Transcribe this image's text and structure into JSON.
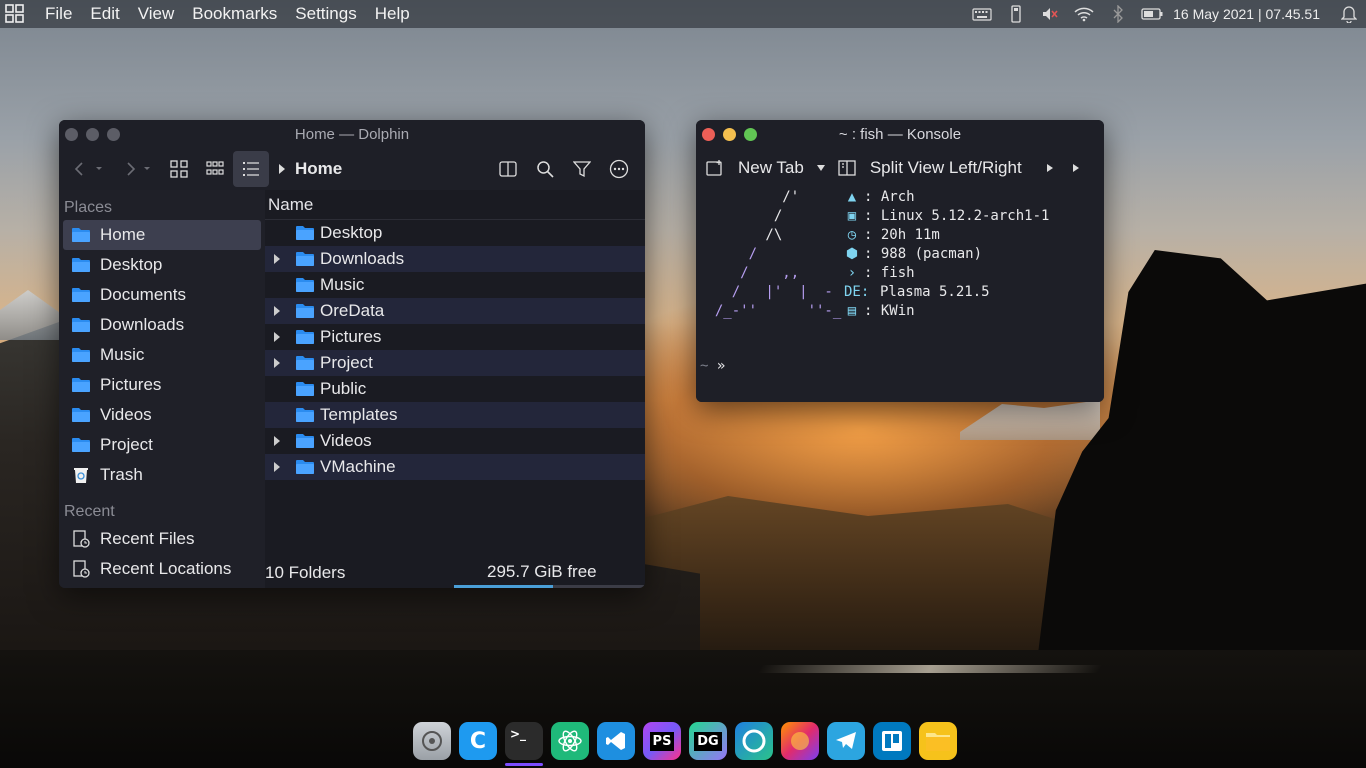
{
  "menubar": {
    "items": [
      "File",
      "Edit",
      "View",
      "Bookmarks",
      "Settings",
      "Help"
    ],
    "clock": "16 May 2021 | 07.45.51",
    "tray_icons": [
      "keyboard-icon",
      "usb-drive-icon",
      "volume-muted-icon",
      "wifi-icon",
      "bluetooth-icon",
      "battery-icon",
      "notification-bell-icon"
    ]
  },
  "dolphin": {
    "title": "Home — Dolphin",
    "breadcrumb": "Home",
    "places_heading": "Places",
    "places": [
      {
        "label": "Home",
        "icon": "home-folder-icon"
      },
      {
        "label": "Desktop",
        "icon": "desktop-folder-icon"
      },
      {
        "label": "Documents",
        "icon": "documents-folder-icon"
      },
      {
        "label": "Downloads",
        "icon": "downloads-folder-icon"
      },
      {
        "label": "Music",
        "icon": "music-folder-icon"
      },
      {
        "label": "Pictures",
        "icon": "pictures-folder-icon"
      },
      {
        "label": "Videos",
        "icon": "videos-folder-icon"
      },
      {
        "label": "Project",
        "icon": "project-folder-icon"
      },
      {
        "label": "Trash",
        "icon": "trash-icon"
      }
    ],
    "recent_heading": "Recent",
    "recent": [
      {
        "label": "Recent Files",
        "icon": "recent-files-icon"
      },
      {
        "label": "Recent Locations",
        "icon": "recent-locations-icon"
      }
    ],
    "column_header": "Name",
    "files": [
      {
        "name": "Desktop",
        "expandable": false
      },
      {
        "name": "Downloads",
        "expandable": true
      },
      {
        "name": "Music",
        "expandable": false
      },
      {
        "name": "OreData",
        "expandable": true
      },
      {
        "name": "Pictures",
        "expandable": true
      },
      {
        "name": "Project",
        "expandable": true
      },
      {
        "name": "Public",
        "expandable": false
      },
      {
        "name": "Templates",
        "expandable": false
      },
      {
        "name": "Videos",
        "expandable": true
      },
      {
        "name": "VMachine",
        "expandable": true
      }
    ],
    "status_count": "10 Folders",
    "free_space": "295.7 GiB free",
    "used_fraction": 0.52
  },
  "konsole": {
    "title": "~ : fish — Konsole",
    "new_tab": "New Tab",
    "split_view": "Split View Left/Right",
    "neofetch": [
      {
        "icon": "arch-linux-icon",
        "text": ": Arch"
      },
      {
        "icon": "kernel-icon",
        "text": ": Linux 5.12.2-arch1-1"
      },
      {
        "icon": "uptime-clock-icon",
        "text": ": 20h 11m"
      },
      {
        "icon": "package-icon",
        "text": ": 988 (pacman)"
      },
      {
        "icon": "shell-icon",
        "text": ": fish"
      },
      {
        "icon": "de-icon",
        "text": "Plasma 5.21.5"
      },
      {
        "icon": "wm-icon",
        "text": ": KWin"
      }
    ],
    "de_label": "DE:",
    "prompt_tilde": "~",
    "prompt_symbol": "»"
  },
  "dock": {
    "apps": [
      {
        "name": "system-settings",
        "label": ""
      },
      {
        "name": "chrome-c",
        "label": "C"
      },
      {
        "name": "terminal",
        "label": ">_"
      },
      {
        "name": "atom",
        "label": ""
      },
      {
        "name": "vscode",
        "label": ""
      },
      {
        "name": "phpstorm",
        "label": "PS"
      },
      {
        "name": "datagrip",
        "label": "DG"
      },
      {
        "name": "edge",
        "label": ""
      },
      {
        "name": "firefox",
        "label": ""
      },
      {
        "name": "telegram",
        "label": ""
      },
      {
        "name": "trello",
        "label": ""
      },
      {
        "name": "files",
        "label": ""
      }
    ],
    "active_app": "terminal"
  },
  "colors": {
    "folder_blue": "#2b8cf0",
    "accent_purple": "#7c4dff",
    "close": "#ec5f57",
    "minimize": "#f4bf4f",
    "maximize": "#61c554"
  }
}
